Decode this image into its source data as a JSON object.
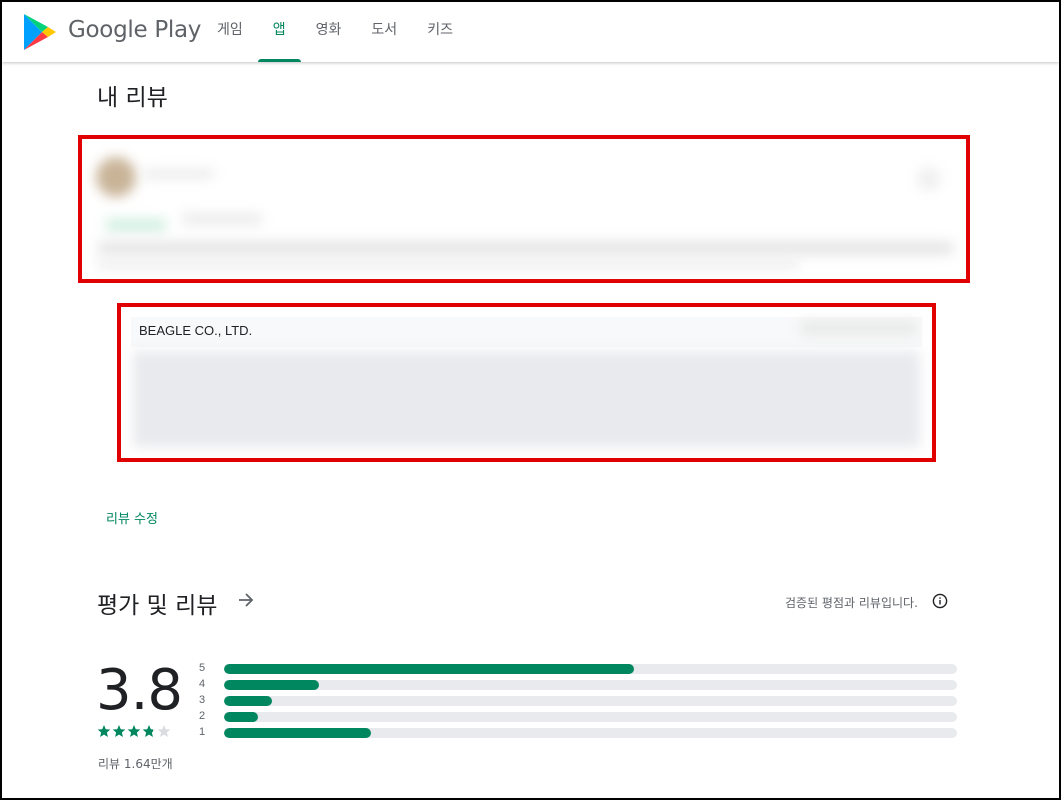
{
  "header": {
    "brand": "Google Play",
    "tabs": [
      {
        "label": "게임",
        "active": false
      },
      {
        "label": "앱",
        "active": true
      },
      {
        "label": "영화",
        "active": false
      },
      {
        "label": "도서",
        "active": false
      },
      {
        "label": "키즈",
        "active": false
      }
    ]
  },
  "my_review": {
    "title": "내 리뷰",
    "developer_reply": {
      "developer": "BEAGLE CO., LTD."
    },
    "edit_label": "리뷰 수정"
  },
  "ratings": {
    "title": "평가 및 리뷰",
    "verified_text": "검증된 평점과 리뷰입니다.",
    "score": "3.8",
    "stars_value": 3.8,
    "review_count": "리뷰 1.64만개",
    "distribution": [
      {
        "label": "5",
        "fraction": 0.56
      },
      {
        "label": "4",
        "fraction": 0.13
      },
      {
        "label": "3",
        "fraction": 0.065
      },
      {
        "label": "2",
        "fraction": 0.047
      },
      {
        "label": "1",
        "fraction": 0.2
      }
    ]
  },
  "colors": {
    "accent": "#01875f",
    "highlight_box": "#e00000"
  },
  "icons": [
    "google-play-logo-icon",
    "arrow-right-icon",
    "info-icon",
    "star-icon"
  ]
}
